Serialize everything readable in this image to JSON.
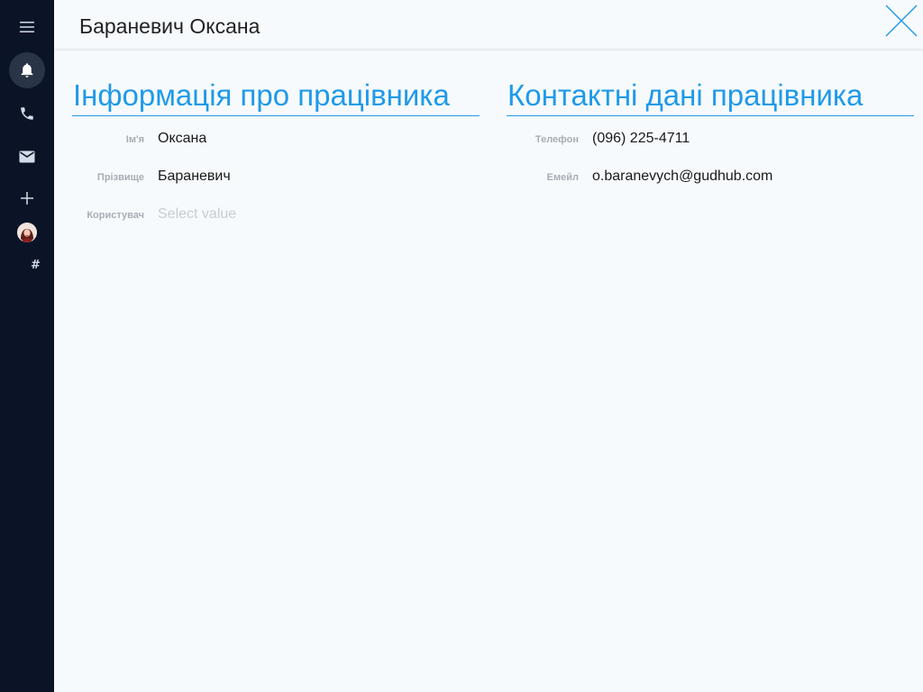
{
  "sidebar": {
    "items": [
      {
        "icon": "menu-icon"
      },
      {
        "icon": "bell-icon",
        "active": true
      },
      {
        "icon": "phone-icon"
      },
      {
        "icon": "mail-icon"
      },
      {
        "icon": "plus-icon"
      },
      {
        "icon": "avatar"
      },
      {
        "icon": "hash-icon",
        "text": "#"
      }
    ]
  },
  "header": {
    "title": "Бараневич Оксана"
  },
  "employee_info": {
    "title": "Інформація про працівника",
    "fields": [
      {
        "label": "Ім'я",
        "value": "Оксана"
      },
      {
        "label": "Прізвище",
        "value": "Бараневич"
      },
      {
        "label": "Користувач",
        "placeholder": "Select value"
      }
    ]
  },
  "contact_info": {
    "title": "Контактні дані працівника",
    "fields": [
      {
        "label": "Телефон",
        "value": "(096) 225-4711"
      },
      {
        "label": "Емейл",
        "value": "o.baranevych@gudhub.com"
      }
    ]
  },
  "colors": {
    "accent": "#1f9ae9",
    "sidebar_bg": "#0b1427",
    "page_bg": "#f7fafc"
  }
}
